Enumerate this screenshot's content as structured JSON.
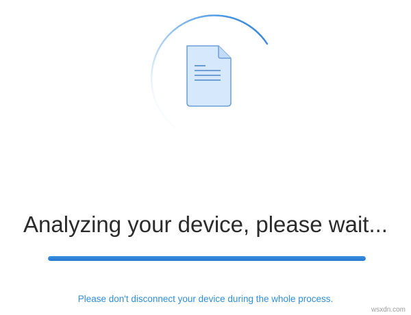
{
  "status": {
    "headline": "Analyzing your device, please wait...",
    "progress_fraction": 1.0,
    "notice": "Please don't disconnect your device during the whole process."
  },
  "spinner": {
    "icon": "document-icon",
    "accent_color": "#2479cf"
  },
  "watermark": {
    "text": "wsxdn.com"
  }
}
